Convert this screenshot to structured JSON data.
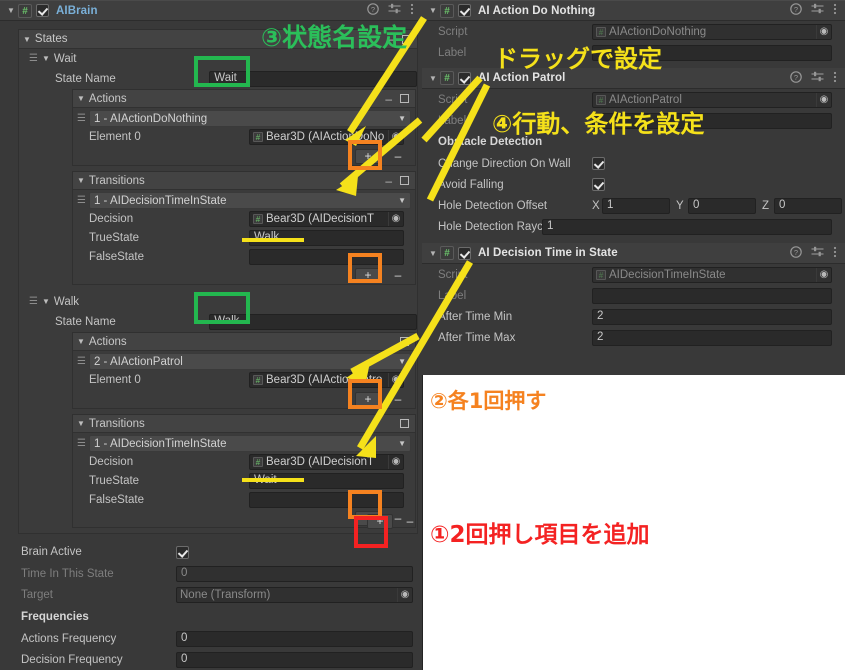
{
  "left_panel": {
    "component": {
      "title": "AIBrain",
      "enabled": true,
      "script_icon": "#",
      "help_icon": "help-icon",
      "preset_icon": "preset-icon",
      "menu_icon": "kebab-menu-icon"
    },
    "states_section": {
      "label": "States",
      "collapse_label": "–",
      "expand_label": "□"
    },
    "states": [
      {
        "name": "Wait",
        "state_name_label": "State Name",
        "state_name_value": "Wait",
        "actions": {
          "label": "Actions",
          "entry": "1 - AIActionDoNothing",
          "element_label": "Element 0",
          "element_value": "Bear3D (AIActionDoNo",
          "add_label": "+",
          "remove_label": "–"
        },
        "transitions": {
          "label": "Transitions",
          "entry": "1 - AIDecisionTimeInState",
          "decision_label": "Decision",
          "decision_value": "Bear3D (AIDecisionT",
          "truestate_label": "TrueState",
          "truestate_value": "Walk",
          "falsestate_label": "FalseState",
          "falsestate_value": "",
          "add_label": "+",
          "remove_label": "–"
        }
      },
      {
        "name": "Walk",
        "state_name_label": "State Name",
        "state_name_value": "Walk",
        "actions": {
          "label": "Actions",
          "entry": "2 - AIActionPatrol",
          "element_label": "Element 0",
          "element_value": "Bear3D (AIActionPatro",
          "add_label": "+",
          "remove_label": "–"
        },
        "transitions": {
          "label": "Transitions",
          "entry": "1 - AIDecisionTimeInState",
          "decision_label": "Decision",
          "decision_value": "Bear3D (AIDecisionT",
          "truestate_label": "TrueState",
          "truestate_value": "Wait",
          "falsestate_label": "FalseState",
          "falsestate_value": "",
          "add_label": "+",
          "remove_label": "–"
        }
      }
    ],
    "states_list_add": "+",
    "states_list_remove": "–",
    "brain_active": {
      "label": "Brain Active",
      "checked": true
    },
    "time_in_this_state": {
      "label": "Time In This State",
      "value": "0"
    },
    "target": {
      "label": "Target",
      "value": "None (Transform)"
    },
    "frequencies_label": "Frequencies",
    "actions_frequency": {
      "label": "Actions Frequency",
      "value": "0"
    },
    "decision_frequency": {
      "label": "Decision Frequency",
      "value": "0"
    }
  },
  "right_panel": {
    "components": [
      {
        "title": "AI Action Do Nothing",
        "enabled": true,
        "fields": [
          {
            "kind": "object",
            "label": "Script",
            "value": "AIActionDoNothing",
            "dim": true
          },
          {
            "kind": "text",
            "label": "Label",
            "value": ""
          }
        ]
      },
      {
        "title": "AI Action Patrol",
        "enabled": true,
        "fields": [
          {
            "kind": "object",
            "label": "Script",
            "value": "AIActionPatrol",
            "dim": true
          },
          {
            "kind": "text",
            "label": "Label",
            "value": ""
          },
          {
            "kind": "header",
            "label": "Obstacle Detection"
          },
          {
            "kind": "check",
            "label": "Change Direction On Wall",
            "checked": true
          },
          {
            "kind": "check",
            "label": "Avoid Falling",
            "checked": true
          },
          {
            "kind": "vector3",
            "label": "Hole Detection Offset",
            "x": "1",
            "y": "0",
            "z": "0"
          },
          {
            "kind": "text",
            "label": "Hole Detection Raycast Len",
            "value": "1"
          }
        ]
      },
      {
        "title": "AI Decision Time in State",
        "enabled": true,
        "fields": [
          {
            "kind": "object",
            "label": "Script",
            "value": "AIDecisionTimeInState",
            "dim": true
          },
          {
            "kind": "text",
            "label": "Label",
            "value": ""
          },
          {
            "kind": "text",
            "label": "After Time Min",
            "value": "2"
          },
          {
            "kind": "text",
            "label": "After Time Max",
            "value": "2"
          }
        ]
      }
    ],
    "vector_axis": {
      "x": "X",
      "y": "Y",
      "z": "Z"
    }
  },
  "annotations": {
    "step3": "③状態名設定",
    "drag": "ドラッグで設定",
    "step4": "④行動、条件を設定",
    "step2": "②各1回押す",
    "step1": "①2回押し項目を追加",
    "colors": {
      "green": "#23b74f",
      "orange": "#f58220",
      "red": "#f42222",
      "yellow": "#f5e11a",
      "jp_green_text": "#2bbf5a"
    }
  }
}
